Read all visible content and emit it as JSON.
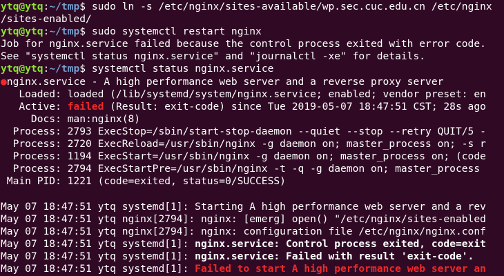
{
  "prompt": {
    "user_host": "ytq@ytq",
    "colon": ":",
    "path": "~/tmp",
    "symbol": "$ "
  },
  "commands": {
    "c1_line1": "sudo ln -s /etc/nginx/sites-available/wp.sec.cuc.edu.cn /etc/nginx",
    "c1_line2": "/sites-enabled/",
    "c2": "sudo systemctl restart nginx",
    "c3": "systemctl status nginx.service"
  },
  "restart_error": {
    "line1": "Job for nginx.service failed because the control process exited with error code.",
    "line2": "See \"systemctl status nginx.service\" and \"journalctl -xe\" for details."
  },
  "status": {
    "dot": "●",
    "unit": "nginx.service - A high performance web server and a reverse proxy server",
    "loaded": "   Loaded: loaded (/lib/systemd/system/nginx.service; enabled; vendor preset: en",
    "active_label": "   Active: ",
    "active_state": "failed",
    "active_rest": " (Result: exit-code) since Tue 2019-05-07 18:47:51 CST; 28s ago",
    "docs": "     Docs: man:nginx(8)",
    "proc1": "  Process: 2793 ExecStop=/sbin/start-stop-daemon --quiet --stop --retry QUIT/5 -",
    "proc2": "  Process: 2720 ExecReload=/usr/sbin/nginx -g daemon on; master_process on; -s r",
    "proc3": "  Process: 1194 ExecStart=/usr/sbin/nginx -g daemon on; master_process on; (code",
    "proc4": "  Process: 2794 ExecStartPre=/usr/sbin/nginx -t -q -g daemon on; master_process",
    "mainpid": " Main PID: 1221 (code=exited, status=0/SUCCESS)"
  },
  "logs": {
    "l1": "May 07 18:47:51 ytq systemd[1]: Starting A high performance web server and a rev",
    "l2": "May 07 18:47:51 ytq nginx[2794]: nginx: [emerg] open() \"/etc/nginx/sites-enabled",
    "l3": "May 07 18:47:51 ytq nginx[2794]: nginx: configuration file /etc/nginx/nginx.conf",
    "l4_prefix": "May 07 18:47:51 ytq systemd[1]: ",
    "l4_msg": "nginx.service: Control process exited, code=exit",
    "l5_prefix": "May 07 18:47:51 ytq systemd[1]: ",
    "l5_msg": "nginx.service: Failed with result 'exit-code'.",
    "l6_prefix": "May 07 18:47:51 ytq systemd[1]: ",
    "l6_msg": "Failed to start A high performance web server an"
  },
  "colors": {
    "background": "#300a24",
    "user": "#8ae234",
    "path": "#729fcf",
    "error": "#ef2929"
  }
}
